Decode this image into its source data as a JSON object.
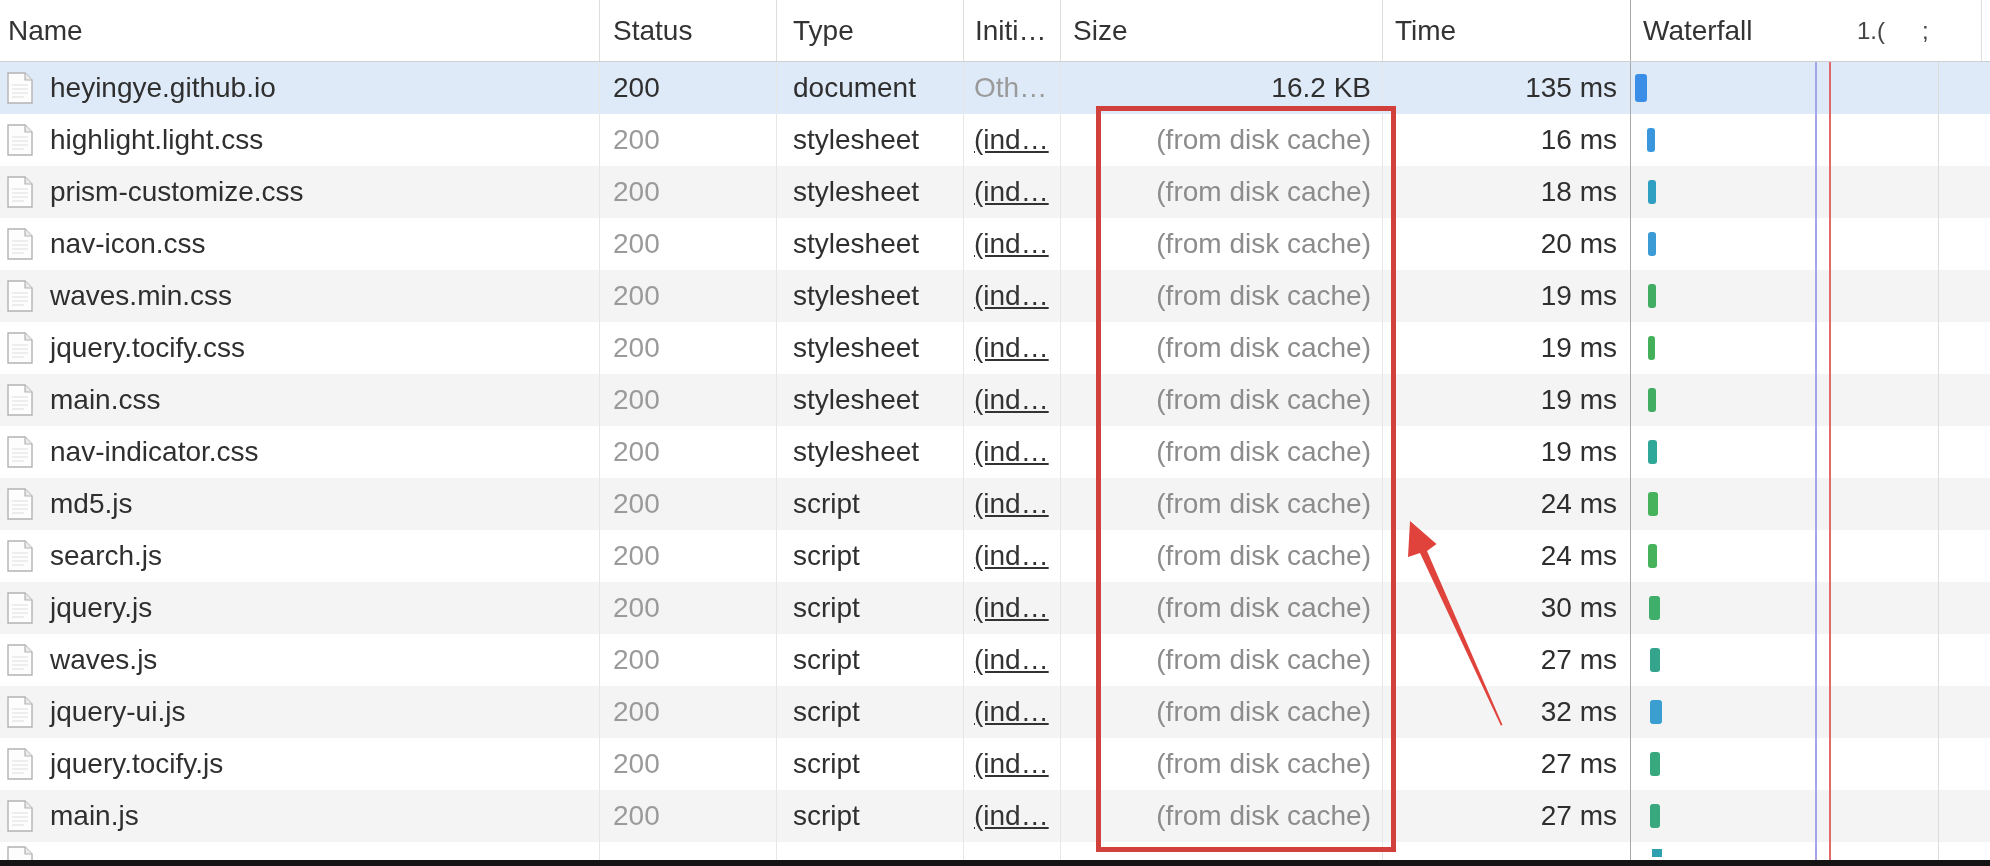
{
  "table": {
    "columns": [
      "Name",
      "Status",
      "Type",
      "Initi…",
      "Size",
      "Time"
    ],
    "waterfall": {
      "label": "Waterfall",
      "ticks": [
        "1.(",
        ";"
      ]
    },
    "rows": [
      {
        "name": "heyingye.github.io",
        "status": "200",
        "type": "document",
        "initiator": "Oth…",
        "initiator_link": false,
        "size": "16.2 KB",
        "time": "135 ms",
        "cached": false,
        "selected": true,
        "color": "#3a8ee6"
      },
      {
        "name": "highlight.light.css",
        "status": "200",
        "type": "stylesheet",
        "initiator": "(ind…",
        "initiator_link": true,
        "size": "(from disk cache)",
        "time": "16 ms",
        "cached": true,
        "selected": false,
        "color": "#3a97dd"
      },
      {
        "name": "prism-customize.css",
        "status": "200",
        "type": "stylesheet",
        "initiator": "(ind…",
        "initiator_link": true,
        "size": "(from disk cache)",
        "time": "18 ms",
        "cached": true,
        "selected": false,
        "color": "#2f9fc2"
      },
      {
        "name": "nav-icon.css",
        "status": "200",
        "type": "stylesheet",
        "initiator": "(ind…",
        "initiator_link": true,
        "size": "(from disk cache)",
        "time": "20 ms",
        "cached": true,
        "selected": false,
        "color": "#3a9bd5"
      },
      {
        "name": "waves.min.css",
        "status": "200",
        "type": "stylesheet",
        "initiator": "(ind…",
        "initiator_link": true,
        "size": "(from disk cache)",
        "time": "19 ms",
        "cached": true,
        "selected": false,
        "color": "#41ad63"
      },
      {
        "name": "jquery.tocify.css",
        "status": "200",
        "type": "stylesheet",
        "initiator": "(ind…",
        "initiator_link": true,
        "size": "(from disk cache)",
        "time": "19 ms",
        "cached": true,
        "selected": false,
        "color": "#44b05a"
      },
      {
        "name": "main.css",
        "status": "200",
        "type": "stylesheet",
        "initiator": "(ind…",
        "initiator_link": true,
        "size": "(from disk cache)",
        "time": "19 ms",
        "cached": true,
        "selected": false,
        "color": "#41ad63"
      },
      {
        "name": "nav-indicator.css",
        "status": "200",
        "type": "stylesheet",
        "initiator": "(ind…",
        "initiator_link": true,
        "size": "(from disk cache)",
        "time": "19 ms",
        "cached": true,
        "selected": false,
        "color": "#2fa89a"
      },
      {
        "name": "md5.js",
        "status": "200",
        "type": "script",
        "initiator": "(ind…",
        "initiator_link": true,
        "size": "(from disk cache)",
        "time": "24 ms",
        "cached": true,
        "selected": false,
        "color": "#46b25c"
      },
      {
        "name": "search.js",
        "status": "200",
        "type": "script",
        "initiator": "(ind…",
        "initiator_link": true,
        "size": "(from disk cache)",
        "time": "24 ms",
        "cached": true,
        "selected": false,
        "color": "#46b25c"
      },
      {
        "name": "jquery.js",
        "status": "200",
        "type": "script",
        "initiator": "(ind…",
        "initiator_link": true,
        "size": "(from disk cache)",
        "time": "30 ms",
        "cached": true,
        "selected": false,
        "color": "#3fae6a"
      },
      {
        "name": "waves.js",
        "status": "200",
        "type": "script",
        "initiator": "(ind…",
        "initiator_link": true,
        "size": "(from disk cache)",
        "time": "27 ms",
        "cached": true,
        "selected": false,
        "color": "#34a58c"
      },
      {
        "name": "jquery-ui.js",
        "status": "200",
        "type": "script",
        "initiator": "(ind…",
        "initiator_link": true,
        "size": "(from disk cache)",
        "time": "32 ms",
        "cached": true,
        "selected": false,
        "color": "#3a9fd0"
      },
      {
        "name": "jquery.tocify.js",
        "status": "200",
        "type": "script",
        "initiator": "(ind…",
        "initiator_link": true,
        "size": "(from disk cache)",
        "time": "27 ms",
        "cached": true,
        "selected": false,
        "color": "#38a97f"
      },
      {
        "name": "main.js",
        "status": "200",
        "type": "script",
        "initiator": "(ind…",
        "initiator_link": true,
        "size": "(from disk cache)",
        "time": "27 ms",
        "cached": true,
        "selected": false,
        "color": "#38a97f"
      }
    ]
  }
}
